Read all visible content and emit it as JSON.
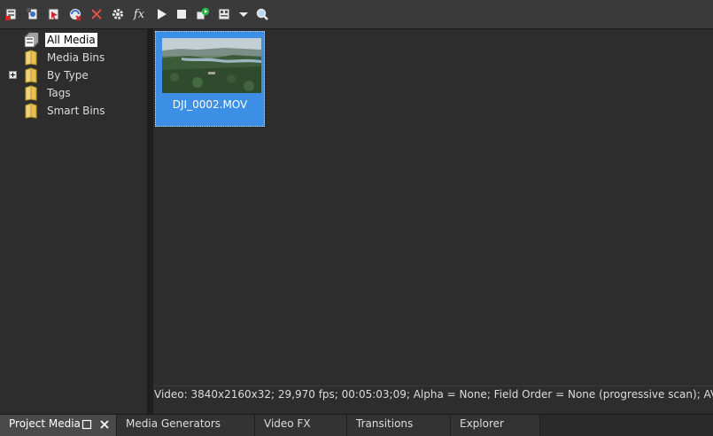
{
  "toolbar": {
    "buttons": [
      {
        "name": "import-media-icon",
        "label": "Import Media"
      },
      {
        "name": "capture-video-icon",
        "label": "Capture Video"
      },
      {
        "name": "get-media-icon",
        "label": "Get Media from the Web"
      },
      {
        "name": "remove-unused-icon",
        "label": "Remove Unused Media"
      },
      {
        "name": "delete-icon",
        "label": "Remove Selected Media"
      },
      {
        "name": "properties-icon",
        "label": "Media Properties"
      },
      {
        "name": "media-fx-icon",
        "label": "Media FX",
        "glyph": "fx"
      },
      {
        "name": "play-icon",
        "label": "Start Preview"
      },
      {
        "name": "stop-icon",
        "label": "Stop Preview"
      },
      {
        "name": "auto-preview-icon",
        "label": "Auto Preview"
      },
      {
        "name": "views-icon",
        "label": "Views"
      },
      {
        "name": "views-dropdown-icon",
        "label": "Views dropdown"
      },
      {
        "name": "search-icon",
        "label": "Search Media Bins"
      }
    ]
  },
  "tree": {
    "items": [
      {
        "label": "All Media",
        "selected": true
      },
      {
        "label": "Media Bins"
      },
      {
        "label": "By Type",
        "expandable": true
      },
      {
        "label": "Tags"
      },
      {
        "label": "Smart Bins"
      }
    ]
  },
  "media": {
    "items": [
      {
        "filename": "DJI_0002.MOV"
      }
    ]
  },
  "status": {
    "text": "Video: 3840x2160x32; 29,970 fps; 00:05:03;09; Alpha = None; Field Order = None (progressive scan); AVC"
  },
  "tabs": [
    {
      "label": "Project Media",
      "active": true
    },
    {
      "label": "Media Generators"
    },
    {
      "label": "Video FX"
    },
    {
      "label": "Transitions"
    },
    {
      "label": "Explorer"
    }
  ],
  "colors": {
    "selection": "#3d8fe6",
    "background": "#2d2d2d",
    "toolbar": "#3a3a3a"
  }
}
